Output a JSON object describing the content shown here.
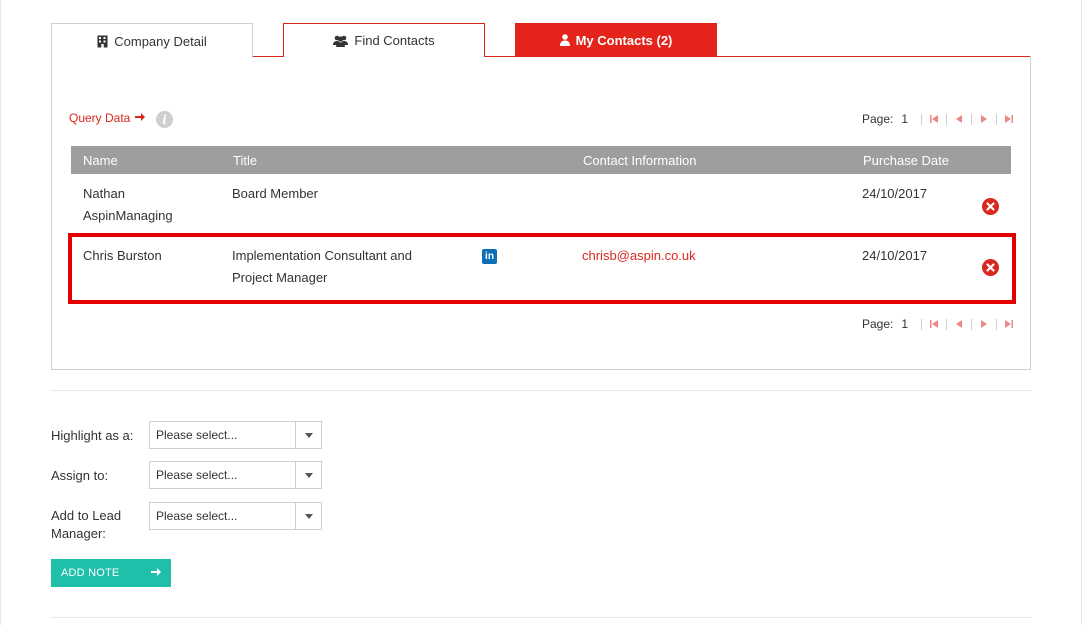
{
  "tabs": [
    {
      "label": "Company Detail",
      "icon": "building-icon"
    },
    {
      "label": "Find Contacts",
      "icon": "users-icon"
    },
    {
      "label": "My Contacts (2)",
      "icon": "user-icon"
    }
  ],
  "query": {
    "label": "Query Data",
    "info_glyph": "i"
  },
  "pager_top": {
    "label": "Page:",
    "page": "1"
  },
  "pager_bottom": {
    "label": "Page:",
    "page": "1"
  },
  "table": {
    "headers": [
      "Name",
      "Title",
      "Contact Information",
      "Purchase Date"
    ],
    "rows": [
      {
        "name_l1": "Nathan",
        "name_l2": "AspinManaging",
        "title_l1": "Board Member",
        "title_l2": "",
        "email": "",
        "date": "24/10/2017"
      },
      {
        "name_l1": "Chris Burston",
        "name_l2": "",
        "title_l1": "Implementation Consultant and",
        "title_l2": "Project Manager",
        "email": "chrisb@aspin.co.uk",
        "date": "24/10/2017",
        "linkedin": "in"
      }
    ]
  },
  "form": {
    "highlight_label": "Highlight as a:",
    "assign_label": "Assign to:",
    "lead_label_l1": "Add to Lead",
    "lead_label_l2": "Manager:",
    "select_placeholder": "Please select..."
  },
  "add_note_label": "ADD NOTE",
  "colors": {
    "accent": "#e4241b",
    "teal": "#1fbfa9",
    "header_gray": "#9e9e9e",
    "linkedin": "#0e6eb8"
  }
}
